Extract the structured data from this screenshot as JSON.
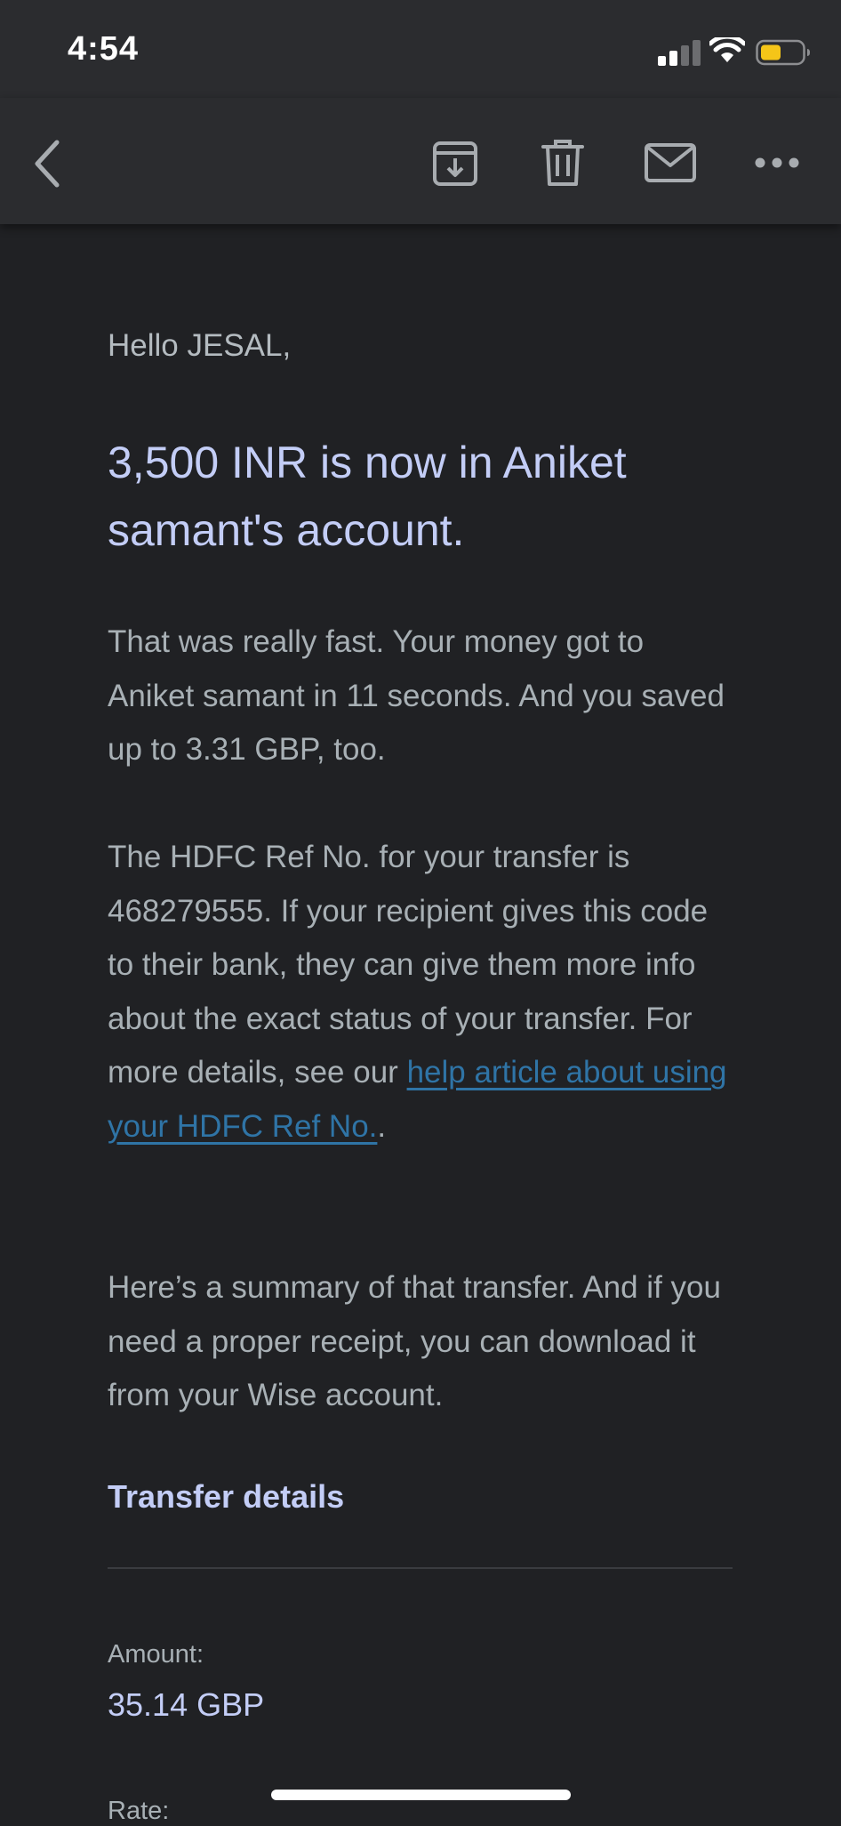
{
  "status_bar": {
    "time": "4:54"
  },
  "toolbar": {
    "back_icon": "chevron-left-icon",
    "archive_icon": "archive-icon",
    "trash_icon": "trash-icon",
    "mail_icon": "mail-icon",
    "more_icon": "more-horizontal-icon"
  },
  "email": {
    "greeting": "Hello JESAL,",
    "headline": "3,500 INR is now in Aniket samant's account.",
    "paragraph_1": "That was really fast. Your money got to Aniket samant in 11 seconds. And you saved up to 3.31 GBP, too.",
    "paragraph_2_text": "The HDFC Ref No. for your transfer is 468279555. If your recipient gives this code to their bank, they can give them more info about the exact status of your transfer. For more details, see our ",
    "paragraph_2_link": "help article about using your HDFC Ref No.",
    "paragraph_2_end": ".",
    "paragraph_3": "Here’s a summary of that transfer. And if you need a proper receipt, you can download it from your Wise account.",
    "section_title": "Transfer details",
    "details": {
      "amount_label": "Amount:",
      "amount_value": "35.14 GBP",
      "rate_label": "Rate:"
    }
  },
  "colors": {
    "background": "#202124",
    "toolbar": "#2b2c2f",
    "headline": "#c3cdf6",
    "body_text": "#a8b0b5",
    "link": "#2f74a6",
    "battery_fill": "#f5c518"
  }
}
